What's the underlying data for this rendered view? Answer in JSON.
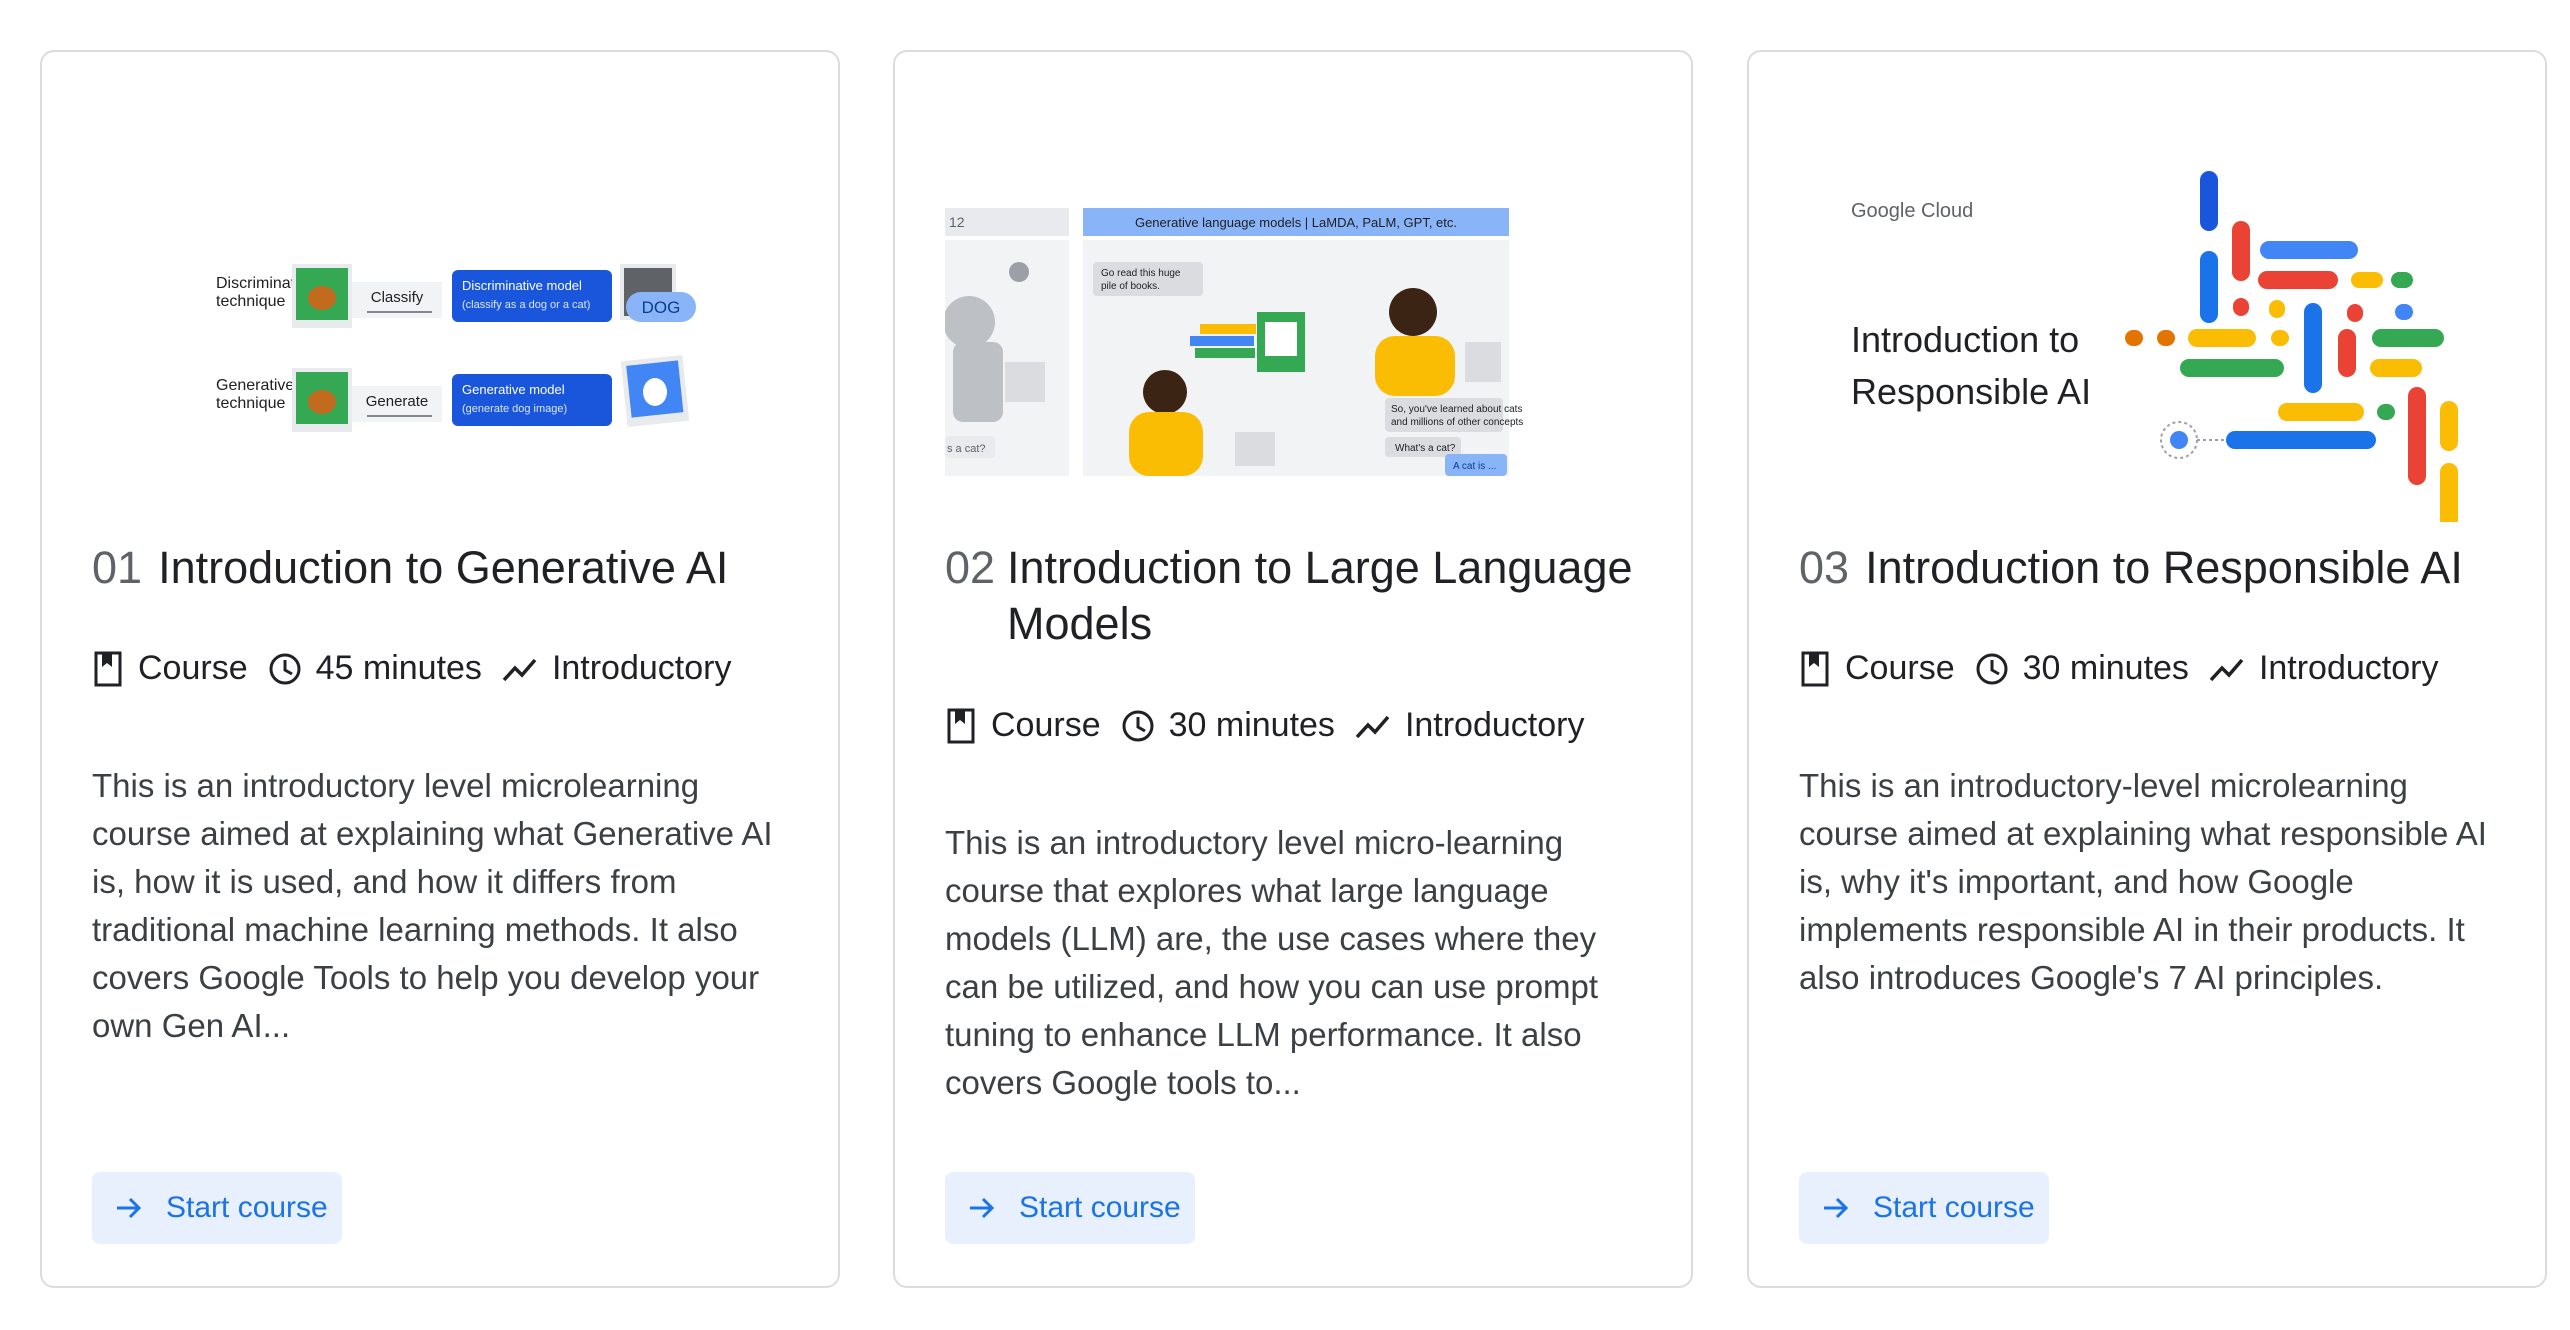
{
  "cards": [
    {
      "number": "01",
      "title": "Introduction to Generative AI",
      "type": "Course",
      "duration": "45 minutes",
      "level": "Introductory",
      "description": "This is an introductory level microlearning course aimed at explaining what Generative AI is, how it is used, and how it differs from traditional machine learning methods. It also covers Google Tools to help you develop your own Gen AI...",
      "button_label": "Start course",
      "thumbnail": {
        "row1_label": "Discriminative technique",
        "row1_action": "Classify",
        "row1_model": "Discriminative model",
        "row1_model_sub": "(classify as a dog or a cat)",
        "row1_output": "DOG",
        "row2_label": "Generative technique",
        "row2_action": "Generate",
        "row2_model": "Generative model",
        "row2_model_sub": "(generate dog image)"
      }
    },
    {
      "number": "02",
      "title": "Introduction to Large Language Models",
      "type": "Course",
      "duration": "30 minutes",
      "level": "Introductory",
      "description": "This is an introductory level micro-learning course that explores what large language models (LLM) are, the use cases where they can be utilized, and how you can use prompt tuning to enhance LLM performance. It also covers Google tools to...",
      "button_label": "Start course",
      "thumbnail": {
        "header": "Generative language models  | LaMDA, PaLM, GPT, etc.",
        "side_number": "12",
        "bubble1": "Go read this huge pile of books.",
        "bubble2": "So, you've learned about cats and millions of other concepts",
        "bubble3": "What's a cat?",
        "bubble4": "A cat is ...",
        "side_bubble": "s a cat?"
      }
    },
    {
      "number": "03",
      "title": "Introduction to Responsible AI",
      "type": "Course",
      "duration": "30 minutes",
      "level": "Introductory",
      "description": "This is an introductory-level microlearning course aimed at explaining what responsible AI is, why it's important, and how Google implements responsible AI in their products. It also introduces Google's 7 AI principles.",
      "button_label": "Start course",
      "thumbnail": {
        "brand": "Google Cloud",
        "heading": "Introduction to Responsible AI"
      }
    }
  ],
  "colors": {
    "accent": "#1a73e8",
    "button_bg": "#e8f0fe",
    "border": "#dadce0",
    "google_blue": "#4285f4",
    "google_red": "#ea4335",
    "google_yellow": "#fbbc04",
    "google_green": "#34a853"
  },
  "icons": {
    "type_icon": "bookmark-icon",
    "duration_icon": "clock-icon",
    "level_icon": "trending-up-icon",
    "button_icon": "arrow-right-icon"
  }
}
